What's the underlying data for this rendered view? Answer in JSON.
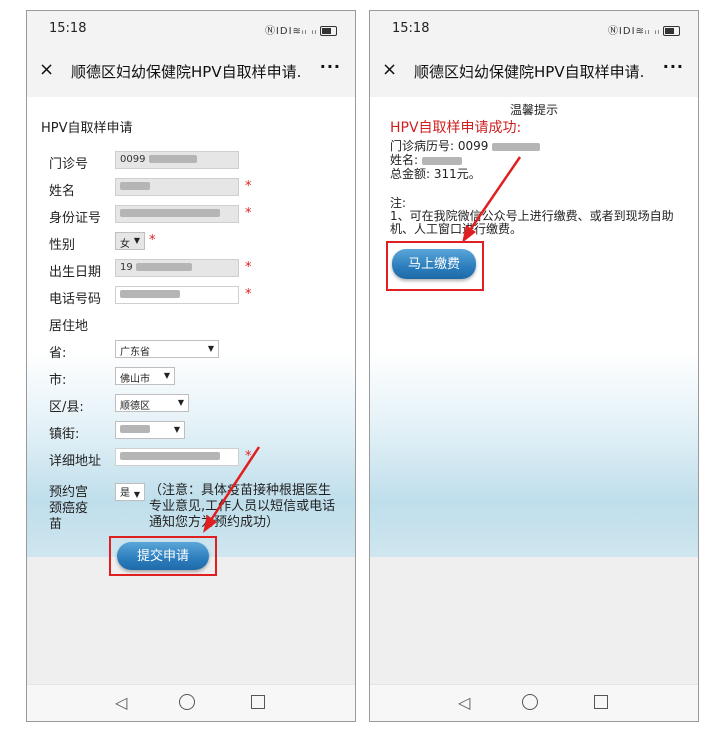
{
  "status_bar": {
    "time": "15:18",
    "icons_text": "ⓃIDI≋ᵢₗ ᵢₗ"
  },
  "nav": {
    "close": "×",
    "title": "顺德区妇幼保健院HPV自取样申请...",
    "more": "···"
  },
  "form": {
    "heading": "HPV自取样申请",
    "fields": [
      {
        "label": "门诊号",
        "value": "0099"
      },
      {
        "label": "姓名",
        "value": ""
      },
      {
        "label": "身份证号",
        "value": ""
      },
      {
        "label": "性别",
        "value": "女"
      },
      {
        "label": "出生日期",
        "value": "19"
      },
      {
        "label": "电话号码",
        "value": ""
      },
      {
        "label": "居住地",
        "value": ""
      },
      {
        "label": "省:",
        "value": "广东省"
      },
      {
        "label": "市:",
        "value": "佛山市"
      },
      {
        "label": "区/县:",
        "value": "顺德区"
      },
      {
        "label": "镇街:",
        "value": ""
      },
      {
        "label": "详细地址",
        "value": ""
      }
    ],
    "required_mark": "*",
    "vaccine_label": "预约宫颈癌疫苗",
    "vaccine_value": "是",
    "vaccine_note": "（注意：具体疫苗接种根据医生专业意见,工作人员以短信或电话通知您方为预约成功）",
    "submit_label": "提交申请"
  },
  "result": {
    "tips_title": "温馨提示",
    "success_text": "HPV自取样申请成功:",
    "record_label": "门诊病历号: 0099",
    "name_label": "姓名:",
    "amount_label": "总金额: 311元。",
    "note_heading": "注:",
    "note_text": "1、可在我院微信公众号上进行缴费、或者到现场自助机、人工窗口进行缴费。",
    "pay_label": "马上缴费"
  },
  "colors": {
    "accent_red": "#e02020",
    "button_blue": "#2b7dbd"
  }
}
